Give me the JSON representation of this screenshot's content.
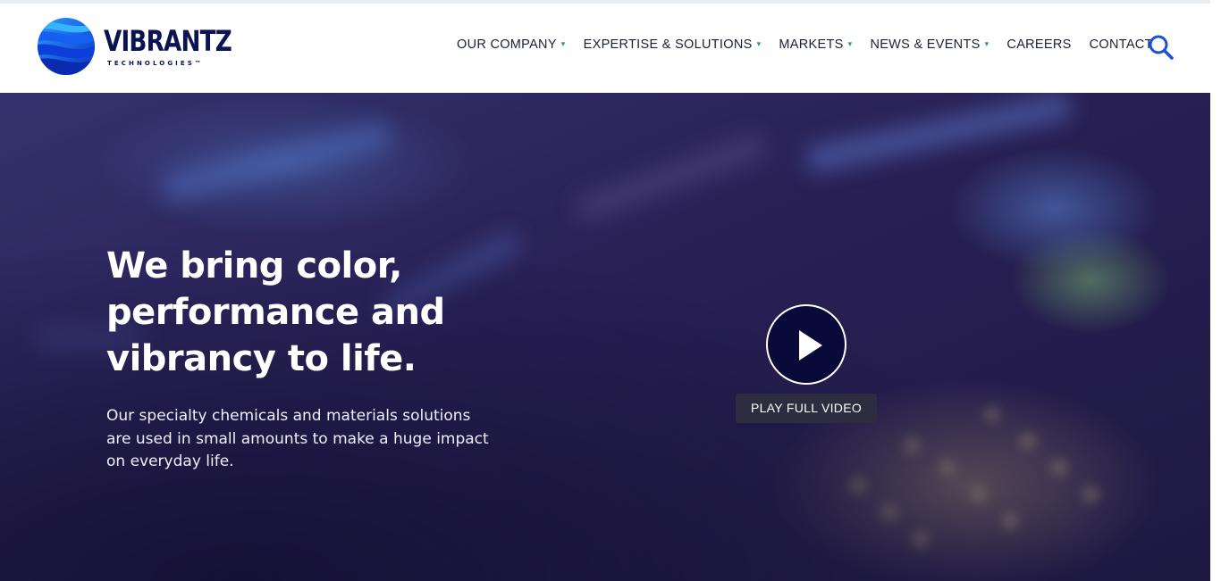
{
  "brand": {
    "name": "VIBRANTZ",
    "tagline": "TECHNOLOGIES™",
    "logo_icon": "globe-stripes-icon",
    "colors": {
      "navy": "#0b1450",
      "blue": "#1e5ee8",
      "caret": "#1f9a78"
    }
  },
  "nav": {
    "items": [
      {
        "label": "OUR COMPANY",
        "has_dropdown": true
      },
      {
        "label": "EXPERTISE & SOLUTIONS",
        "has_dropdown": true
      },
      {
        "label": "MARKETS",
        "has_dropdown": true
      },
      {
        "label": "NEWS & EVENTS",
        "has_dropdown": true
      },
      {
        "label": "CAREERS",
        "has_dropdown": false
      },
      {
        "label": "CONTACT",
        "has_dropdown": false
      }
    ],
    "dropdown_glyph": "▾",
    "search_icon": "search-icon"
  },
  "hero": {
    "title": "We bring color, performance and vibrancy to life.",
    "subtitle": "Our specialty chemicals and materials solutions are used in small amounts to make a huge impact on everyday life.",
    "play_icon": "play-icon",
    "play_label": "PLAY FULL VIDEO",
    "colors": {
      "overlay": "#2a2156",
      "play_button": "#080a3a"
    }
  }
}
